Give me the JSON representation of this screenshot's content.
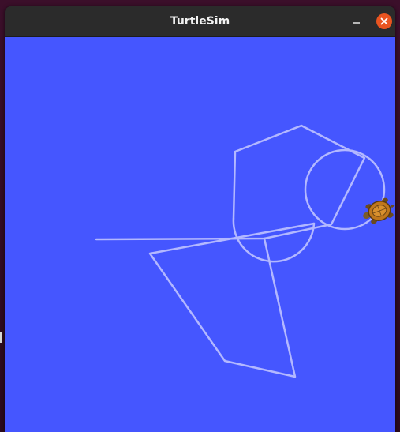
{
  "window": {
    "title": "TurtleSim"
  },
  "colors": {
    "background": "#4556ff",
    "pen": "#b3b8ff",
    "titlebar": "#2b2b2b",
    "close_button": "#e95420"
  },
  "icons": {
    "minimize": "minimize-icon",
    "close": "close-icon",
    "turtle": "turtle-icon"
  }
}
